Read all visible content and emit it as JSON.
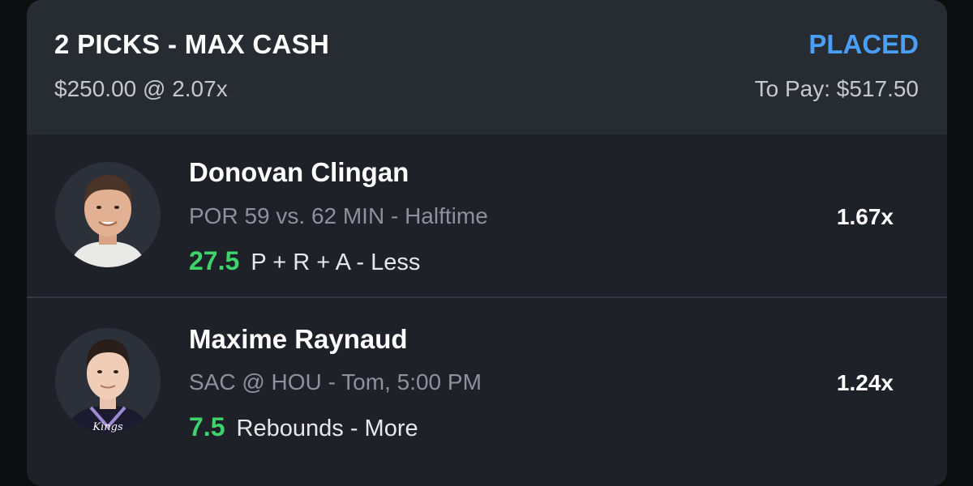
{
  "entry": {
    "title": "2 PICKS - MAX CASH",
    "status": "PLACED",
    "stake_line": "$250.00 @ 2.07x",
    "to_pay": "To Pay: $517.50"
  },
  "picks": [
    {
      "player": "Donovan Clingan",
      "game": "POR 59 vs. 62 MIN",
      "game_status": "Halftime",
      "line_value": "27.5",
      "stat": "P + R + A",
      "direction": "Less",
      "multiplier": "1.67x",
      "avatar_icon": "player-headshot"
    },
    {
      "player": "Maxime Raynaud",
      "game": "SAC @ HOU",
      "game_status": "Tom, 5:00 PM",
      "line_value": "7.5",
      "stat": "Rebounds",
      "direction": "More",
      "multiplier": "1.24x",
      "avatar_icon": "player-headshot",
      "jersey_text": "Kings"
    }
  ],
  "colors": {
    "status": "#4a9ef5",
    "line_value": "#3fd46b",
    "card_bg": "#1e2127",
    "header_bg": "#272b32"
  }
}
